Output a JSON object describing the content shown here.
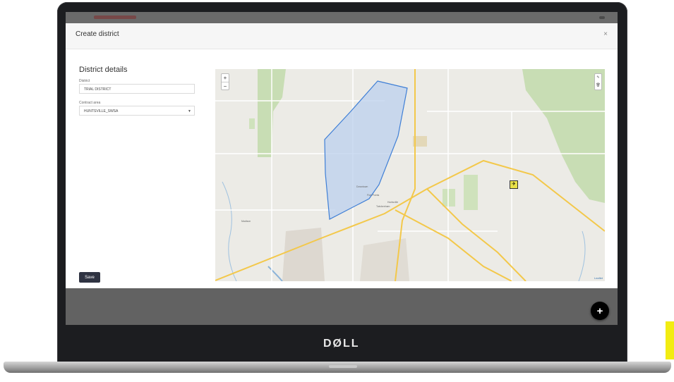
{
  "modal": {
    "title": "Create district",
    "close_label": "×",
    "section_title": "District details",
    "district_label": "District",
    "district_value": "TRIAL DISTRICT",
    "contract_area_label": "Contract area",
    "contract_area_value": "HUNTSVILLE_SWSA",
    "save_label": "Save"
  },
  "map": {
    "zoom_in": "+",
    "zoom_out": "−",
    "attribution": "Leaflet",
    "labels": {
      "huntsville": "Huntsville",
      "madison": "Madison",
      "twickenham": "Twickenham",
      "downtown": "Downtown",
      "five_points": "Five Points"
    }
  },
  "fab_label": "+",
  "brand": "DØLL",
  "icons": [
    "close-icon",
    "zoom-in-icon",
    "zoom-out-icon",
    "edit-icon",
    "trash-icon",
    "airport-icon",
    "chevron-down-icon",
    "plus-icon"
  ],
  "colors": {
    "polygon_fill": "#bcd0ee",
    "polygon_stroke": "#3f7fd6",
    "save_button": "#2f3342",
    "road_major": "#f3c84a"
  }
}
